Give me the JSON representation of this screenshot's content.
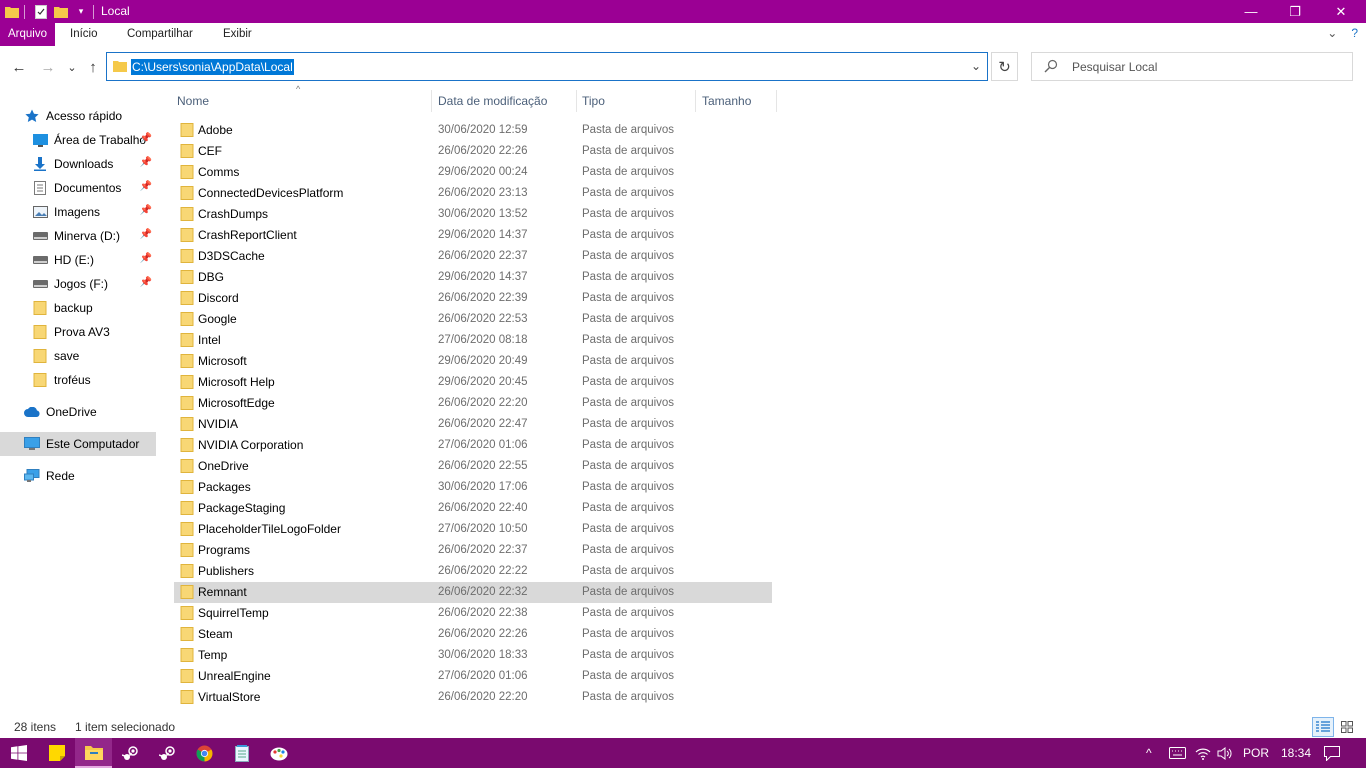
{
  "window": {
    "title": "Local",
    "controls": {
      "minimize": "—",
      "restore": "❐",
      "close": "✕"
    }
  },
  "ribbon": {
    "tabs": [
      {
        "label": "Arquivo",
        "active": true
      },
      {
        "label": "Início"
      },
      {
        "label": "Compartilhar"
      },
      {
        "label": "Exibir"
      }
    ],
    "expand_glyph": "⌄",
    "help_glyph": "?"
  },
  "nav": {
    "back_glyph": "←",
    "forward_glyph": "→",
    "recent_glyph": "⌄",
    "up_glyph": "↑",
    "address_path": "C:\\Users\\sonia\\AppData\\Local",
    "address_dropdown_glyph": "⌄",
    "refresh_glyph": "↻",
    "search_placeholder": "Pesquisar Local"
  },
  "sidebar": {
    "items": [
      {
        "label": "Acesso rápido",
        "icon": "star-icon"
      },
      {
        "label": "Área de Trabalho",
        "icon": "desktop-icon",
        "pinned": true
      },
      {
        "label": "Downloads",
        "icon": "download-icon",
        "pinned": true
      },
      {
        "label": "Documentos",
        "icon": "document-icon",
        "pinned": true
      },
      {
        "label": "Imagens",
        "icon": "image-icon",
        "pinned": true
      },
      {
        "label": "Minerva (D:)",
        "icon": "drive-icon",
        "pinned": true
      },
      {
        "label": "HD (E:)",
        "icon": "drive-icon",
        "pinned": true
      },
      {
        "label": "Jogos (F:)",
        "icon": "drive-icon",
        "pinned": true
      },
      {
        "label": "backup",
        "icon": "folder-icon"
      },
      {
        "label": "Prova AV3",
        "icon": "folder-icon"
      },
      {
        "label": "save",
        "icon": "folder-icon"
      },
      {
        "label": "troféus",
        "icon": "folder-icon"
      },
      {
        "label": "OneDrive",
        "icon": "cloud-icon"
      },
      {
        "label": "Este Computador",
        "icon": "computer-icon",
        "selected": true
      },
      {
        "label": "Rede",
        "icon": "network-icon"
      }
    ]
  },
  "columns": {
    "name": "Nome",
    "date": "Data de modificação",
    "type": "Tipo",
    "size": "Tamanho",
    "sort_glyph": "^"
  },
  "files": [
    {
      "name": "Adobe",
      "date": "30/06/2020 12:59",
      "type": "Pasta de arquivos"
    },
    {
      "name": "CEF",
      "date": "26/06/2020 22:26",
      "type": "Pasta de arquivos"
    },
    {
      "name": "Comms",
      "date": "29/06/2020 00:24",
      "type": "Pasta de arquivos"
    },
    {
      "name": "ConnectedDevicesPlatform",
      "date": "26/06/2020 23:13",
      "type": "Pasta de arquivos"
    },
    {
      "name": "CrashDumps",
      "date": "30/06/2020 13:52",
      "type": "Pasta de arquivos"
    },
    {
      "name": "CrashReportClient",
      "date": "29/06/2020 14:37",
      "type": "Pasta de arquivos"
    },
    {
      "name": "D3DSCache",
      "date": "26/06/2020 22:37",
      "type": "Pasta de arquivos"
    },
    {
      "name": "DBG",
      "date": "29/06/2020 14:37",
      "type": "Pasta de arquivos"
    },
    {
      "name": "Discord",
      "date": "26/06/2020 22:39",
      "type": "Pasta de arquivos"
    },
    {
      "name": "Google",
      "date": "26/06/2020 22:53",
      "type": "Pasta de arquivos"
    },
    {
      "name": "Intel",
      "date": "27/06/2020 08:18",
      "type": "Pasta de arquivos"
    },
    {
      "name": "Microsoft",
      "date": "29/06/2020 20:49",
      "type": "Pasta de arquivos"
    },
    {
      "name": "Microsoft Help",
      "date": "29/06/2020 20:45",
      "type": "Pasta de arquivos"
    },
    {
      "name": "MicrosoftEdge",
      "date": "26/06/2020 22:20",
      "type": "Pasta de arquivos"
    },
    {
      "name": "NVIDIA",
      "date": "26/06/2020 22:47",
      "type": "Pasta de arquivos"
    },
    {
      "name": "NVIDIA Corporation",
      "date": "27/06/2020 01:06",
      "type": "Pasta de arquivos"
    },
    {
      "name": "OneDrive",
      "date": "26/06/2020 22:55",
      "type": "Pasta de arquivos"
    },
    {
      "name": "Packages",
      "date": "30/06/2020 17:06",
      "type": "Pasta de arquivos"
    },
    {
      "name": "PackageStaging",
      "date": "26/06/2020 22:40",
      "type": "Pasta de arquivos"
    },
    {
      "name": "PlaceholderTileLogoFolder",
      "date": "27/06/2020 10:50",
      "type": "Pasta de arquivos"
    },
    {
      "name": "Programs",
      "date": "26/06/2020 22:37",
      "type": "Pasta de arquivos"
    },
    {
      "name": "Publishers",
      "date": "26/06/2020 22:22",
      "type": "Pasta de arquivos"
    },
    {
      "name": "Remnant",
      "date": "26/06/2020 22:32",
      "type": "Pasta de arquivos",
      "selected": true
    },
    {
      "name": "SquirrelTemp",
      "date": "26/06/2020 22:38",
      "type": "Pasta de arquivos"
    },
    {
      "name": "Steam",
      "date": "26/06/2020 22:26",
      "type": "Pasta de arquivos"
    },
    {
      "name": "Temp",
      "date": "30/06/2020 18:33",
      "type": "Pasta de arquivos"
    },
    {
      "name": "UnrealEngine",
      "date": "27/06/2020 01:06",
      "type": "Pasta de arquivos"
    },
    {
      "name": "VirtualStore",
      "date": "26/06/2020 22:20",
      "type": "Pasta de arquivos"
    }
  ],
  "status": {
    "item_count": "28 itens",
    "selection": "1 item selecionado"
  },
  "taskbar": {
    "apps": [
      {
        "name": "sticky-notes-icon"
      },
      {
        "name": "file-explorer-icon",
        "active": true
      },
      {
        "name": "steam-icon"
      },
      {
        "name": "steam-icon"
      },
      {
        "name": "chrome-icon"
      },
      {
        "name": "notepad-icon"
      },
      {
        "name": "paint-icon"
      }
    ],
    "tray": {
      "chevron_glyph": "^",
      "language": "POR",
      "time": "18:34"
    }
  },
  "colors": {
    "accent": "#9b0094",
    "taskbar": "#7a0a6f",
    "selection": "#0078d7",
    "folder": "#f5c94a"
  }
}
